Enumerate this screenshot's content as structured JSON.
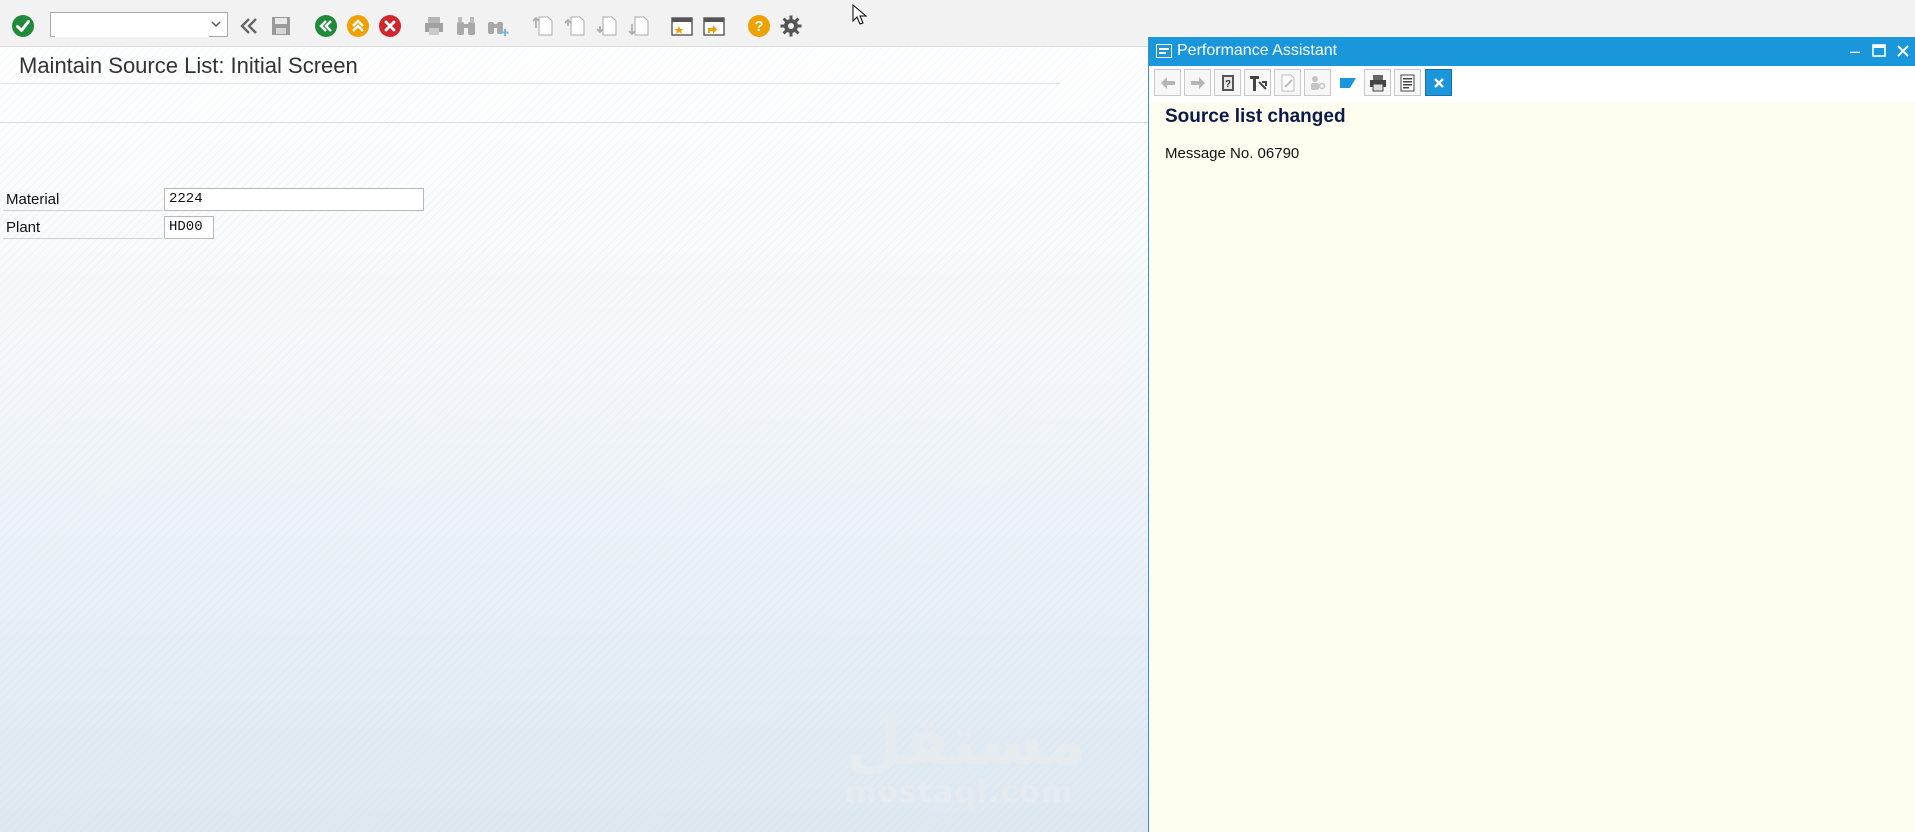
{
  "toolbar": {
    "command_field_value": "",
    "icons": [
      "enter-icon",
      "back-icon",
      "save-icon",
      "back-nav-icon",
      "exit-icon",
      "cancel-icon",
      "print-icon",
      "find-icon",
      "find-next-icon",
      "first-page-icon",
      "previous-page-icon",
      "next-page-icon",
      "last-page-icon",
      "create-session-icon",
      "shortcut-icon",
      "help-icon",
      "settings-icon"
    ]
  },
  "main": {
    "title": "Maintain Source List: Initial Screen",
    "fields": [
      {
        "label": "Material",
        "value": "2224"
      },
      {
        "label": "Plant",
        "value": "HD00"
      }
    ],
    "watermark": {
      "arabic": "مستقل",
      "latin": "mostaql.com"
    }
  },
  "assistant": {
    "title": "Performance Assistant",
    "heading": "Source list changed",
    "message": "Message No. 06790"
  },
  "colors": {
    "accent": "#1a96db",
    "enter_green": "#1e8a3a",
    "exit_orange": "#f0a000",
    "cancel_red": "#d0262d",
    "help_orange": "#f0a000"
  }
}
